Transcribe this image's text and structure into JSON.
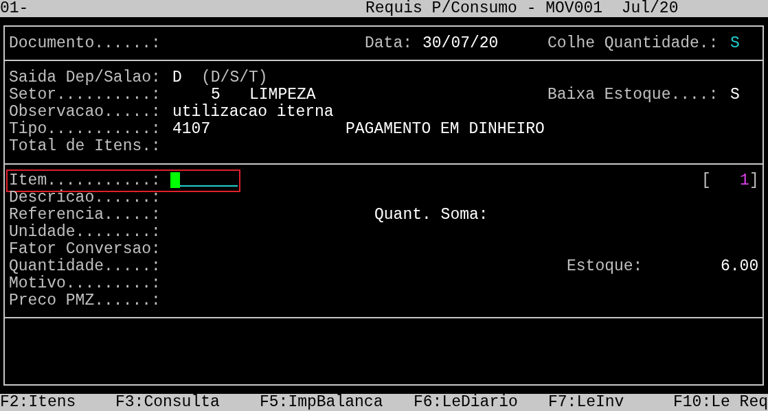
{
  "title_bar": {
    "left": "01-",
    "title": "Requis P/Consumo - MOV001  Jul/20"
  },
  "header": {
    "documento_label": "Documento......:",
    "data_label": "Data:",
    "data_value": "30/07/20",
    "colhe_label": "Colhe Quantidade.:",
    "colhe_value": "S"
  },
  "details": [
    {
      "label": "Saida Dep/Salao:",
      "value": "D",
      "hint": "(D/S/T)"
    },
    {
      "label": "Setor..........:",
      "code": "5",
      "value": "LIMPEZA",
      "side_label": "Baixa Estoque....:",
      "side_value": "S"
    },
    {
      "label": "Observacao.....:",
      "value": "utilizacao iterna"
    },
    {
      "label": "Tipo...........:",
      "code": "4107",
      "value": "PAGAMENTO EM DINHEIRO"
    },
    {
      "label": "Total de Itens.:"
    }
  ],
  "item_fields": [
    {
      "label": "Item...........:",
      "kind": "input",
      "focused": true,
      "highlighted": true,
      "counter": {
        "open": "[",
        "value": "1",
        "close": "]"
      }
    },
    {
      "label": "Descricao......:",
      "kind": "text"
    },
    {
      "label": "Referencia.....:",
      "kind": "text",
      "side_label": "Quant. Soma:"
    },
    {
      "label": "Unidade........:",
      "kind": "text"
    },
    {
      "label": "Fator Conversao:",
      "kind": "text"
    },
    {
      "label": "Quantidade.....:",
      "kind": "text",
      "side_label": "Estoque:",
      "side_value": "6.00"
    },
    {
      "label": "Motivo.........:",
      "kind": "text"
    },
    {
      "label": "Preco PMZ......:",
      "kind": "text"
    }
  ],
  "function_keys": [
    "F2:Itens",
    "F3:Consulta",
    "F5:ImpBalanca",
    "F6:LeDiario",
    "F7:LeInv",
    "F10:Le Req"
  ]
}
